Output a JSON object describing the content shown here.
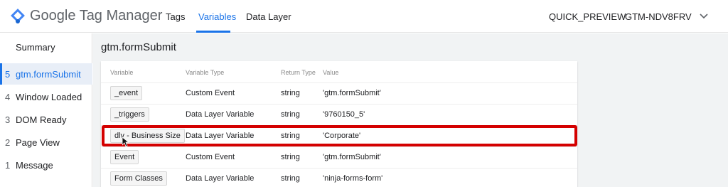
{
  "header": {
    "brand": "Google Tag Manager",
    "tabs": [
      {
        "label": "Tags",
        "active": false
      },
      {
        "label": "Variables",
        "active": true
      },
      {
        "label": "Data Layer",
        "active": false
      }
    ],
    "quick_preview": "QUICK_PREVIEW",
    "container_id": "GTM-NDV8FRV",
    "accent_color": "#1a73e8"
  },
  "sidebar": {
    "summary": "Summary",
    "items": [
      {
        "num": "5",
        "label": "gtm.formSubmit",
        "active": true
      },
      {
        "num": "4",
        "label": "Window Loaded",
        "active": false
      },
      {
        "num": "3",
        "label": "DOM Ready",
        "active": false
      },
      {
        "num": "2",
        "label": "Page View",
        "active": false
      },
      {
        "num": "1",
        "label": "Message",
        "active": false
      }
    ]
  },
  "main": {
    "title": "gtm.formSubmit",
    "columns": {
      "variable": "Variable",
      "type": "Variable Type",
      "return": "Return Type",
      "value": "Value"
    },
    "rows": [
      {
        "variable": "_event",
        "type": "Custom Event",
        "return": "string",
        "value": "'gtm.formSubmit'"
      },
      {
        "variable": "_triggers",
        "type": "Data Layer Variable",
        "return": "string",
        "value": "'9760150_5'"
      },
      {
        "variable": "dlv - Business Size",
        "type": "Data Layer Variable",
        "return": "string",
        "value": "'Corporate'"
      },
      {
        "variable": "Event",
        "type": "Custom Event",
        "return": "string",
        "value": "'gtm.formSubmit'"
      },
      {
        "variable": "Form Classes",
        "type": "Data Layer Variable",
        "return": "string",
        "value": "'ninja-forms-form'"
      }
    ],
    "highlight_color": "#d40000"
  }
}
